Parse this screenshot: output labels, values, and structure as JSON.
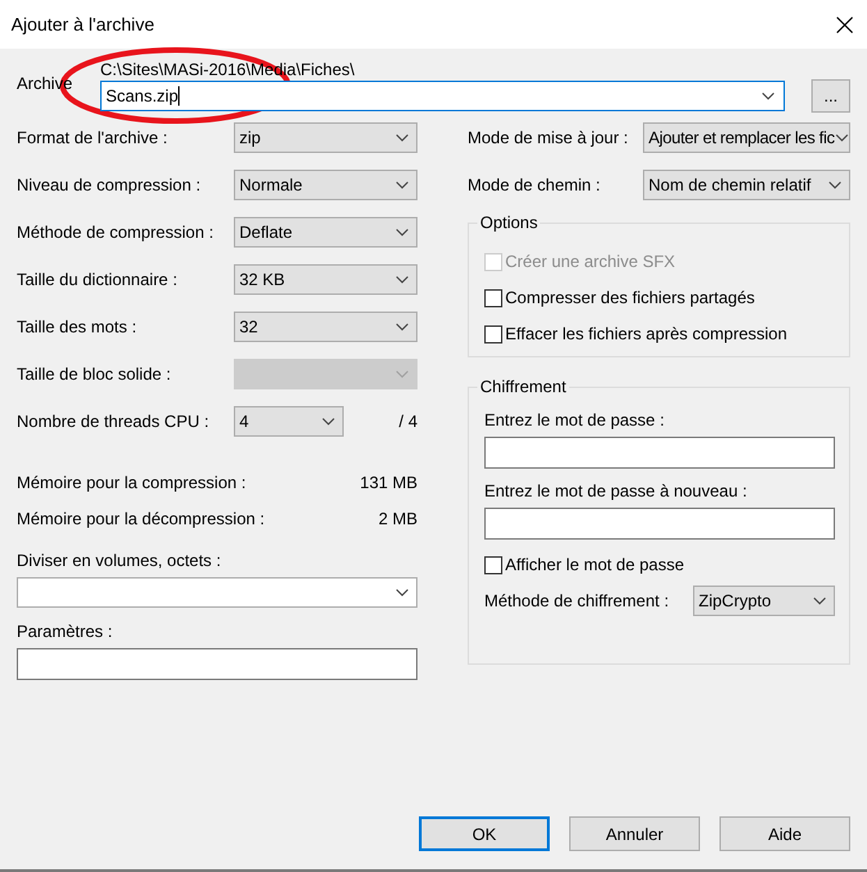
{
  "window": {
    "title": "Ajouter à l'archive"
  },
  "archive": {
    "label": "Archive",
    "path": "C:\\Sites\\MASi-2016\\Media\\Fiches\\",
    "value": "Scans.zip",
    "browse": "..."
  },
  "settings": [
    {
      "label": "Format de l'archive :",
      "value": "zip",
      "disabled": false
    },
    {
      "label": "Niveau de compression :",
      "value": "Normale",
      "disabled": false
    },
    {
      "label": "Méthode de compression :",
      "value": "Deflate",
      "disabled": false
    },
    {
      "label": "Taille du dictionnaire :",
      "value": "32 KB",
      "disabled": false
    },
    {
      "label": "Taille des mots :",
      "value": "32",
      "disabled": false
    },
    {
      "label": "Taille de bloc solide :",
      "disabled": true
    },
    {
      "label": "Nombre de threads CPU :",
      "value": "4",
      "disabled": false,
      "suffix": "/ 4"
    }
  ],
  "memory": [
    {
      "label": "Mémoire pour la compression :",
      "value": "131 MB"
    },
    {
      "label": "Mémoire pour la décompression :",
      "value": "2 MB"
    }
  ],
  "split": {
    "label": "Diviser en volumes, octets :"
  },
  "parameters": {
    "label": "Paramètres :"
  },
  "modes": [
    {
      "label": "Mode de mise à jour :",
      "value": "Ajouter et remplacer les fic"
    },
    {
      "label": "Mode de chemin :",
      "value": "Nom de chemin relatif"
    }
  ],
  "options": {
    "title": "Options",
    "items": [
      {
        "label": "Créer une archive SFX",
        "checked": false,
        "disabled": true
      },
      {
        "label": "Compresser des fichiers partagés",
        "checked": false,
        "disabled": false
      },
      {
        "label": "Effacer les fichiers après compression",
        "checked": false,
        "disabled": false
      }
    ]
  },
  "encryption": {
    "title": "Chiffrement",
    "password_label": "Entrez le mot de passe :",
    "repeat_label": "Entrez le mot de passe à nouveau :",
    "show_password": {
      "label": "Afficher le mot de passe",
      "checked": false,
      "disabled": false
    },
    "method_label": "Méthode de chiffrement :",
    "method": "ZipCrypto"
  },
  "buttons": [
    {
      "label": "OK",
      "default": true
    },
    {
      "label": "Annuler",
      "default": false
    },
    {
      "label": "Aide",
      "default": false
    }
  ]
}
